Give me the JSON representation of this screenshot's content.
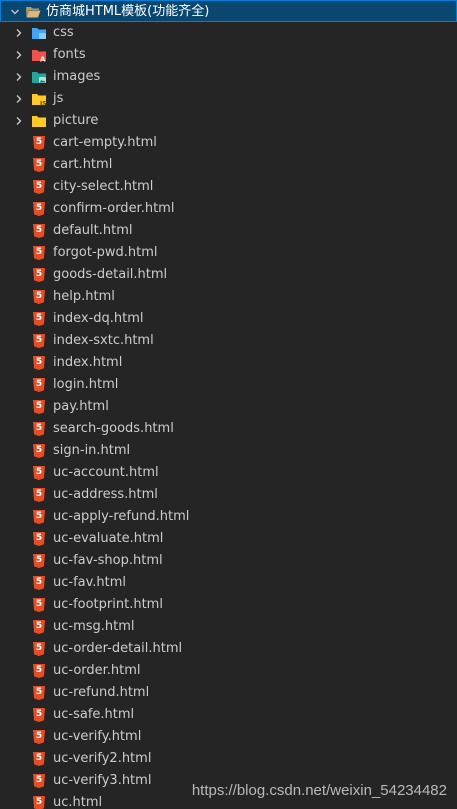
{
  "root": {
    "label": "仿商城HTML模板(功能齐全)",
    "icon": "folder-open-icon",
    "color": "#dcb67a",
    "expanded": true
  },
  "folders": [
    {
      "label": "css",
      "icon": "css-folder-icon",
      "color": "#42a5f5"
    },
    {
      "label": "fonts",
      "icon": "fonts-folder-icon",
      "color": "#ef5350"
    },
    {
      "label": "images",
      "icon": "images-folder-icon",
      "color": "#26a69a"
    },
    {
      "label": "js",
      "icon": "js-folder-icon",
      "color": "#ffca28"
    },
    {
      "label": "picture",
      "icon": "folder-icon",
      "color": "#ffca28"
    }
  ],
  "files": [
    "cart-empty.html",
    "cart.html",
    "city-select.html",
    "confirm-order.html",
    "default.html",
    "forgot-pwd.html",
    "goods-detail.html",
    "help.html",
    "index-dq.html",
    "index-sxtc.html",
    "index.html",
    "login.html",
    "pay.html",
    "search-goods.html",
    "sign-in.html",
    "uc-account.html",
    "uc-address.html",
    "uc-apply-refund.html",
    "uc-evaluate.html",
    "uc-fav-shop.html",
    "uc-fav.html",
    "uc-footprint.html",
    "uc-msg.html",
    "uc-order-detail.html",
    "uc-order.html",
    "uc-refund.html",
    "uc-safe.html",
    "uc-verify.html",
    "uc-verify2.html",
    "uc-verify3.html",
    "uc.html"
  ],
  "file_icon": "html5-icon",
  "file_icon_color": "#e44d26",
  "watermark": "https://blog.csdn.net/weixin_54234482",
  "colors": {
    "background": "#252526",
    "selection": "#094771",
    "text": "#cccccc"
  }
}
